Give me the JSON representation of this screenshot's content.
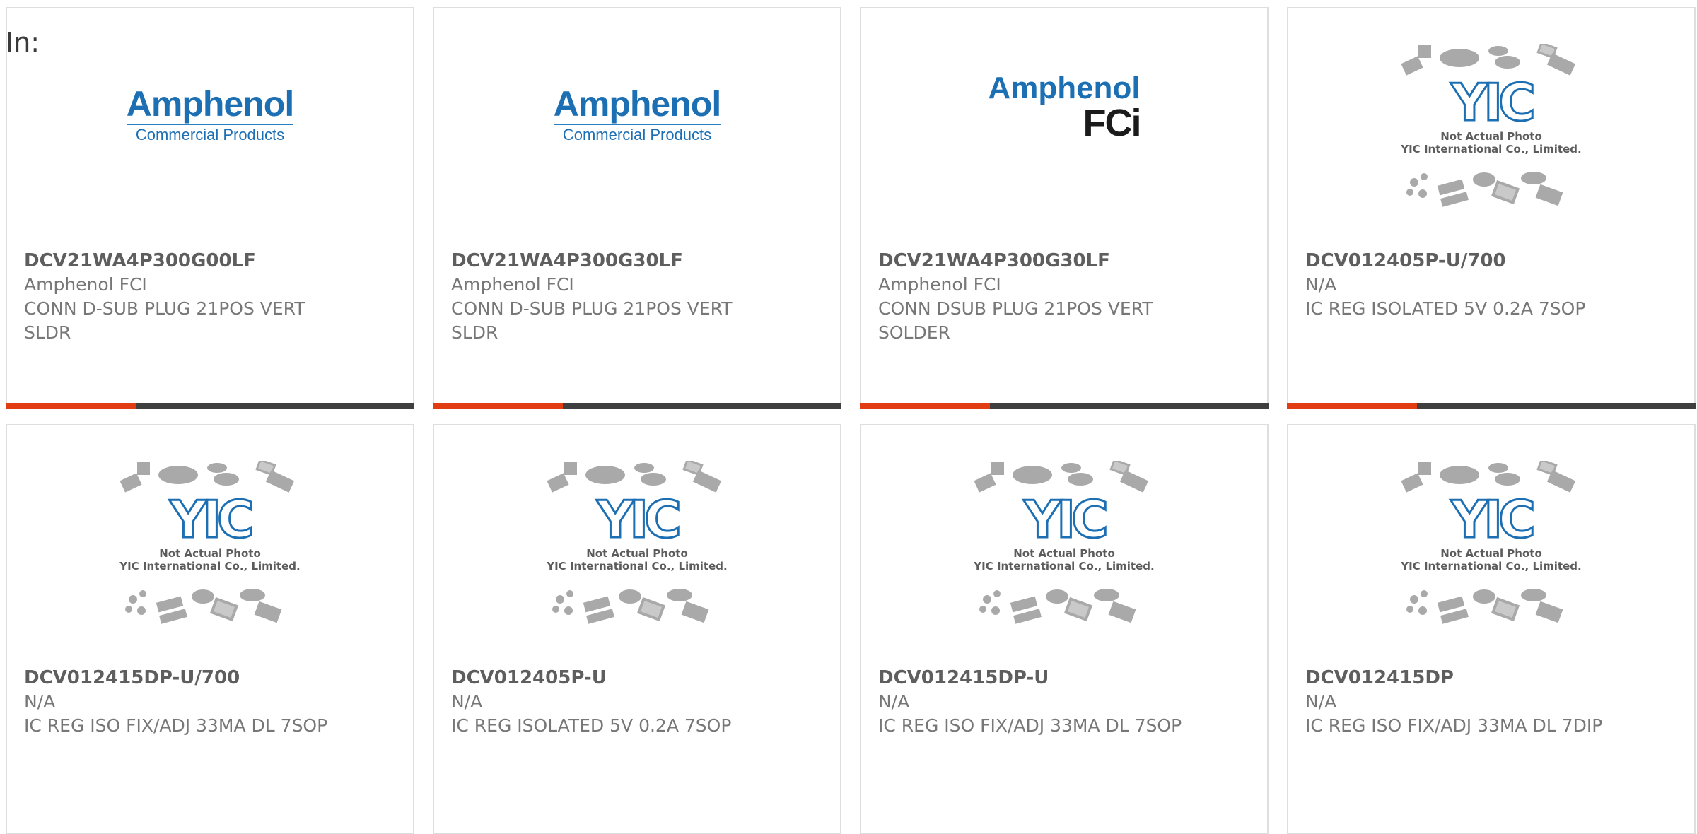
{
  "header": {
    "in_label": "In:"
  },
  "logos": {
    "amphenol_commercial": {
      "title": "Amphenol",
      "subtitle": "Commercial Products"
    },
    "amphenol_fci": {
      "title": "Amphenol",
      "subtitle": "FCi"
    },
    "yic_placeholder": {
      "line1": "Not Actual Photo",
      "line2": "YIC International Co., Limited.",
      "mark": "YIC"
    }
  },
  "products": [
    {
      "part_number": "DCV21WA4P300G00LF",
      "manufacturer": "Amphenol FCI",
      "description": "CONN D-SUB PLUG 21POS VERT SLDR",
      "image": "amphenol-commercial-logo"
    },
    {
      "part_number": "DCV21WA4P300G30LF",
      "manufacturer": "Amphenol FCI",
      "description": "CONN D-SUB PLUG 21POS VERT SLDR",
      "image": "amphenol-commercial-logo"
    },
    {
      "part_number": "DCV21WA4P300G30LF",
      "manufacturer": "Amphenol FCI",
      "description": "CONN DSUB PLUG 21POS VERT SOLDER",
      "image": "amphenol-fci-logo"
    },
    {
      "part_number": "DCV012405P-U/700",
      "manufacturer": "N/A",
      "description": "IC REG ISOLATED 5V 0.2A 7SOP",
      "image": "yic-placeholder"
    },
    {
      "part_number": "DCV012415DP-U/700",
      "manufacturer": "N/A",
      "description": "IC REG ISO FIX/ADJ 33MA DL 7SOP",
      "image": "yic-placeholder"
    },
    {
      "part_number": "DCV012405P-U",
      "manufacturer": "N/A",
      "description": "IC REG ISOLATED 5V 0.2A 7SOP",
      "image": "yic-placeholder"
    },
    {
      "part_number": "DCV012415DP-U",
      "manufacturer": "N/A",
      "description": "IC REG ISO FIX/ADJ 33MA DL 7SOP",
      "image": "yic-placeholder"
    },
    {
      "part_number": "DCV012415DP",
      "manufacturer": "N/A",
      "description": "IC REG ISO FIX/ADJ 33MA DL 7DIP",
      "image": "yic-placeholder"
    }
  ],
  "colors": {
    "accent": "#e23c12",
    "bar": "#3f3f3f",
    "brand_blue": "#1d6fb3"
  }
}
